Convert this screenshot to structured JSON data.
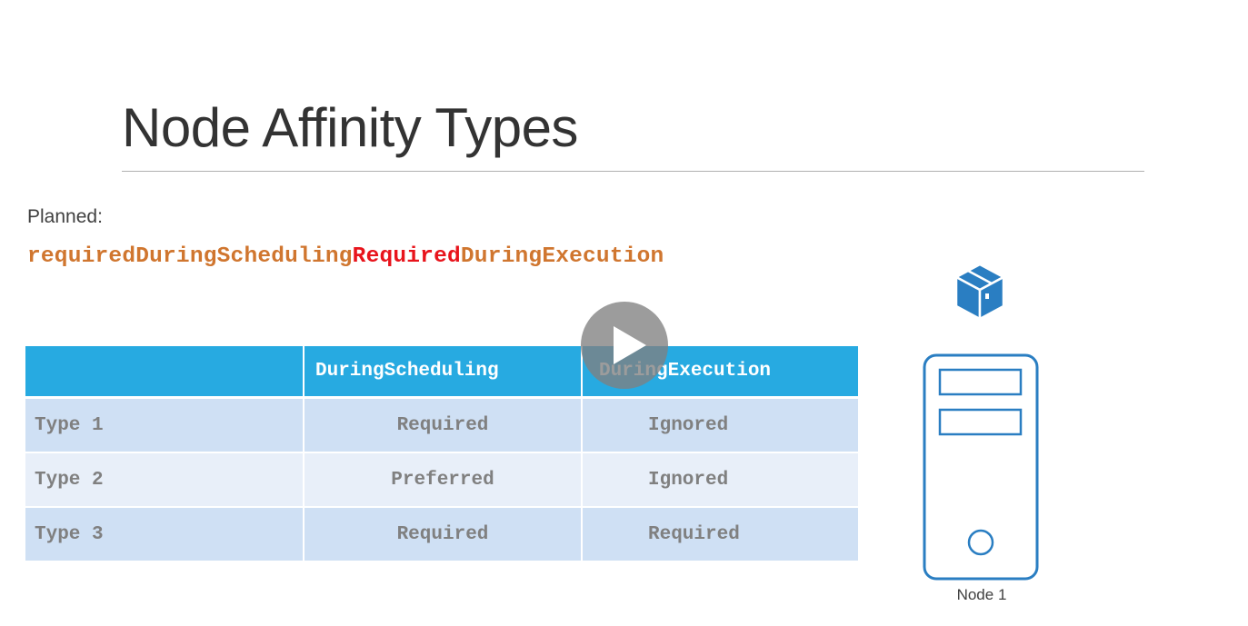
{
  "slide": {
    "title": "Node Affinity Types",
    "planned_label": "Planned:",
    "affinity_name": {
      "prefix": "requiredDuringScheduling",
      "highlight": "Required",
      "suffix": "DuringExecution"
    }
  },
  "table": {
    "headers": [
      "",
      "DuringScheduling",
      "DuringExecution"
    ],
    "rows": [
      {
        "type": "Type 1",
        "during_scheduling": "Required",
        "during_execution": "Ignored"
      },
      {
        "type": "Type 2",
        "during_scheduling": "Preferred",
        "during_execution": "Ignored"
      },
      {
        "type": "Type 3",
        "during_scheduling": "Required",
        "during_execution": "Required"
      }
    ]
  },
  "diagram": {
    "pod_icon": "pod-cube-icon",
    "node_icon": "server-node-icon",
    "node_label": "Node 1"
  },
  "player": {
    "play_icon": "play-icon"
  },
  "colors": {
    "accent_blue": "#27aae1",
    "icon_blue": "#2a7ec2",
    "code_orange": "#d0762f",
    "code_red": "#e8141c",
    "row_dark": "#cfe0f4",
    "row_light": "#e8eff9"
  }
}
